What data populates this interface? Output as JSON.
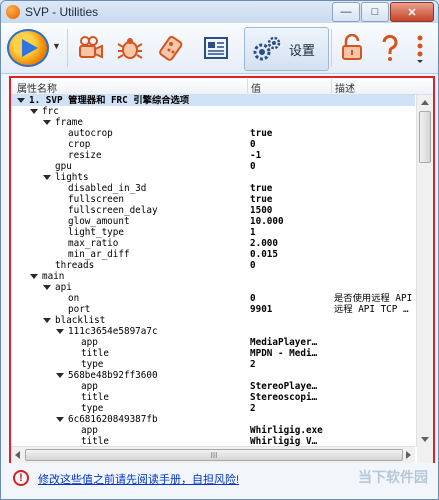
{
  "window": {
    "title": "SVP - Utilities",
    "btn_min": "—",
    "btn_max": "□",
    "btn_close": "✕"
  },
  "toolbar": {
    "logo_caret": "▼",
    "settings_label": "设置",
    "buttons": [
      "camera-icon",
      "bug-icon",
      "remote-icon",
      "document-icon",
      "gear-icon",
      "unlock-icon",
      "help-icon"
    ]
  },
  "table": {
    "columns": {
      "name": "属性名称",
      "value": "值",
      "desc": "描述"
    },
    "rows": [
      {
        "level": 0,
        "toggle": true,
        "label": "1. SVP 管理器和 FRC 引擎综合选项",
        "value": "",
        "desc": "",
        "selected": true,
        "bold": true
      },
      {
        "level": 1,
        "toggle": true,
        "label": "frc",
        "value": "",
        "desc": ""
      },
      {
        "level": 2,
        "toggle": true,
        "label": "frame",
        "value": "",
        "desc": ""
      },
      {
        "level": 3,
        "toggle": false,
        "label": "autocrop",
        "value": "true",
        "desc": ""
      },
      {
        "level": 3,
        "toggle": false,
        "label": "crop",
        "value": "0",
        "desc": ""
      },
      {
        "level": 3,
        "toggle": false,
        "label": "resize",
        "value": "-1",
        "desc": ""
      },
      {
        "level": 2,
        "toggle": false,
        "label": "gpu",
        "value": "0",
        "desc": ""
      },
      {
        "level": 2,
        "toggle": true,
        "label": "lights",
        "value": "",
        "desc": ""
      },
      {
        "level": 3,
        "toggle": false,
        "label": "disabled_in_3d",
        "value": "true",
        "desc": ""
      },
      {
        "level": 3,
        "toggle": false,
        "label": "fullscreen",
        "value": "true",
        "desc": ""
      },
      {
        "level": 3,
        "toggle": false,
        "label": "fullscreen_delay",
        "value": "1500",
        "desc": ""
      },
      {
        "level": 3,
        "toggle": false,
        "label": "glow_amount",
        "value": "10.000",
        "desc": ""
      },
      {
        "level": 3,
        "toggle": false,
        "label": "light_type",
        "value": "1",
        "desc": ""
      },
      {
        "level": 3,
        "toggle": false,
        "label": "max_ratio",
        "value": "2.000",
        "desc": ""
      },
      {
        "level": 3,
        "toggle": false,
        "label": "min_ar_diff",
        "value": "0.015",
        "desc": ""
      },
      {
        "level": 2,
        "toggle": false,
        "label": "threads",
        "value": "0",
        "desc": ""
      },
      {
        "level": 1,
        "toggle": true,
        "label": "main",
        "value": "",
        "desc": ""
      },
      {
        "level": 2,
        "toggle": true,
        "label": "api",
        "value": "",
        "desc": ""
      },
      {
        "level": 3,
        "toggle": false,
        "label": "on",
        "value": "0",
        "desc": "是否使用远程 API"
      },
      {
        "level": 3,
        "toggle": false,
        "label": "port",
        "value": "9901",
        "desc": "远程 API TCP …"
      },
      {
        "level": 2,
        "toggle": true,
        "label": "blacklist",
        "value": "",
        "desc": ""
      },
      {
        "level": 3,
        "toggle": true,
        "label": "111c3654e5897a7c",
        "value": "",
        "desc": ""
      },
      {
        "level": 4,
        "toggle": false,
        "label": "app",
        "value": "MediaPlayer…",
        "desc": ""
      },
      {
        "level": 4,
        "toggle": false,
        "label": "title",
        "value": "MPDN - Medi…",
        "desc": ""
      },
      {
        "level": 4,
        "toggle": false,
        "label": "type",
        "value": "2",
        "desc": ""
      },
      {
        "level": 3,
        "toggle": true,
        "label": "568be48b92ff3600",
        "value": "",
        "desc": ""
      },
      {
        "level": 4,
        "toggle": false,
        "label": "app",
        "value": "StereoPlaye…",
        "desc": ""
      },
      {
        "level": 4,
        "toggle": false,
        "label": "title",
        "value": "Stereoscopi…",
        "desc": ""
      },
      {
        "level": 4,
        "toggle": false,
        "label": "type",
        "value": "2",
        "desc": ""
      },
      {
        "level": 3,
        "toggle": true,
        "label": "6c681620849387fb",
        "value": "",
        "desc": ""
      },
      {
        "level": 4,
        "toggle": false,
        "label": "app",
        "value": "Whirligig.exe",
        "desc": ""
      },
      {
        "level": 4,
        "toggle": false,
        "label": "title",
        "value": "Whirligig V…",
        "desc": ""
      }
    ]
  },
  "scroll": {
    "thumb_grip": "III"
  },
  "footer": {
    "warning_icon": "!",
    "warning_text": "修改这些值之前请先阅读手册，自担风险!",
    "watermark": "当下软件园"
  }
}
